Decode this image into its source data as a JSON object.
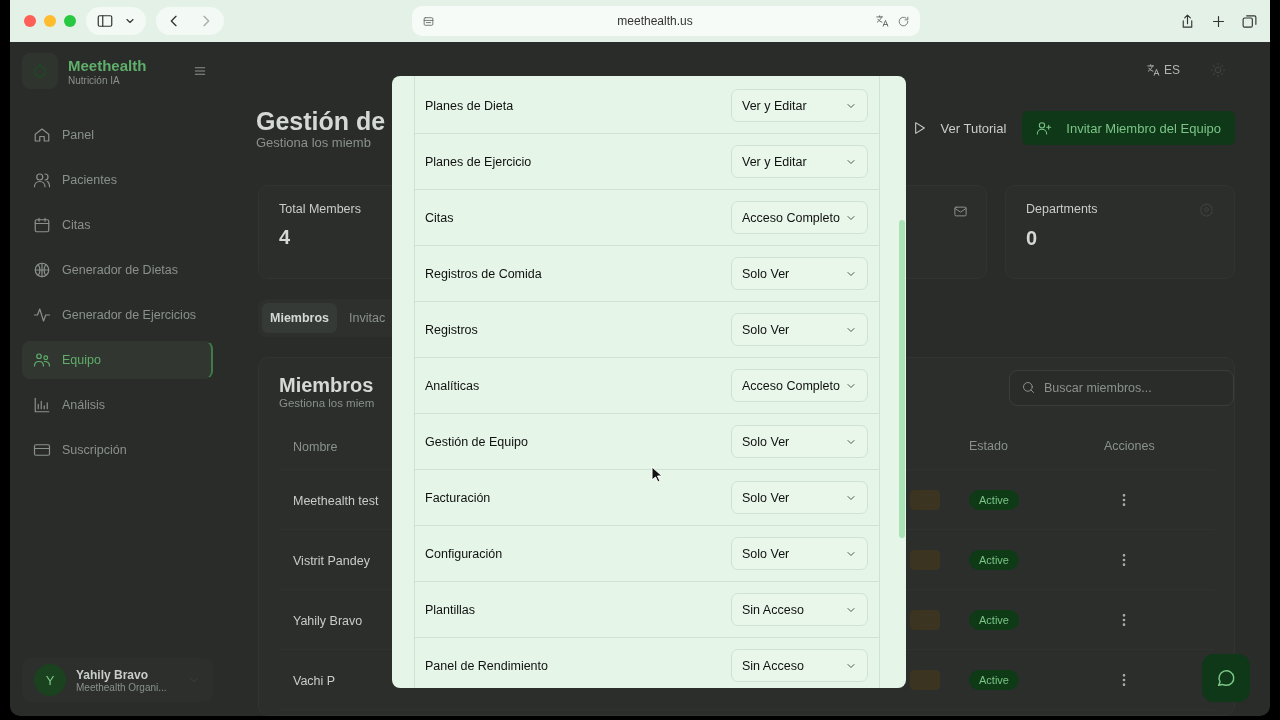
{
  "browser": {
    "url": "meethealth.us"
  },
  "sidebar": {
    "brand": "Meethealth",
    "tagline": "Nutrición IA",
    "items": [
      {
        "label": "Panel",
        "selected": false
      },
      {
        "label": "Pacientes",
        "selected": false
      },
      {
        "label": "Citas",
        "selected": false
      },
      {
        "label": "Generador de Dietas",
        "selected": false
      },
      {
        "label": "Generador de Ejercicios",
        "selected": false
      },
      {
        "label": "Equipo",
        "selected": true
      },
      {
        "label": "Análisis",
        "selected": false
      },
      {
        "label": "Suscripción",
        "selected": false
      }
    ],
    "user": {
      "initial": "Y",
      "name": "Yahily Bravo",
      "org": "Meethealth Organi..."
    }
  },
  "topbar": {
    "language": "ES"
  },
  "header": {
    "title": "Gestión de",
    "subtitle": "Gestiona los miemb",
    "tutorial_button": "Ver Tutorial",
    "invite_button": "Invitar Miembro del Equipo"
  },
  "stats": [
    {
      "label": "Total Members",
      "value": "4"
    },
    {
      "label": "Departments",
      "value": "0"
    }
  ],
  "tabs": [
    {
      "label": "Miembros",
      "selected": true
    },
    {
      "label": "Invitac",
      "selected": false
    }
  ],
  "members": {
    "title": "Miembros",
    "subtitle": "Gestiona los miem",
    "search_placeholder": "Buscar miembros...",
    "columns": [
      "Nombre",
      "Estado",
      "Acciones"
    ],
    "rows": [
      {
        "name": "Meethealth test",
        "status": "Active"
      },
      {
        "name": "Vistrit Pandey",
        "status": "Active"
      },
      {
        "name": "Yahily Bravo",
        "status": "Active"
      },
      {
        "name": "Vachi P",
        "status": "Active"
      }
    ]
  },
  "dialog": {
    "permissions": [
      {
        "area": "Planes de Dieta",
        "access": "Ver y Editar"
      },
      {
        "area": "Planes de Ejercicio",
        "access": "Ver y Editar"
      },
      {
        "area": "Citas",
        "access": "Acceso Completo"
      },
      {
        "area": "Registros de Comida",
        "access": "Solo Ver"
      },
      {
        "area": "Registros",
        "access": "Solo Ver"
      },
      {
        "area": "Analíticas",
        "access": "Acceso Completo"
      },
      {
        "area": "Gestión de Equipo",
        "access": "Solo Ver"
      },
      {
        "area": "Facturación",
        "access": "Solo Ver"
      },
      {
        "area": "Configuración",
        "access": "Solo Ver"
      },
      {
        "area": "Plantillas",
        "access": "Sin Acceso"
      },
      {
        "area": "Panel de Rendimiento",
        "access": "Sin Acceso"
      }
    ]
  }
}
